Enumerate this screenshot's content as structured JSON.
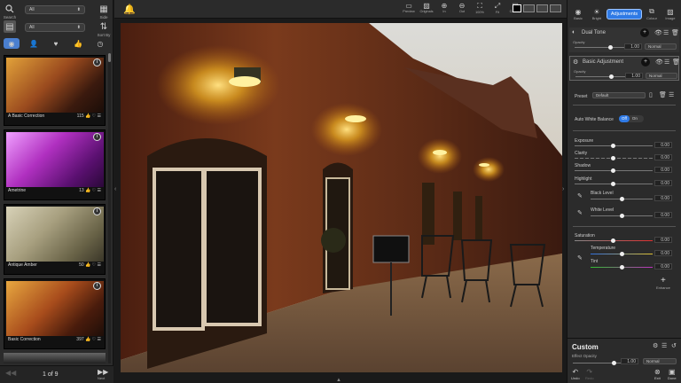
{
  "left_panel": {
    "search_label": "Search",
    "side_label": "Side",
    "sort_label": "Sort By",
    "filter_top": "All",
    "filter_bottom": "All",
    "category_icons": [
      "grid-icon",
      "person-icon",
      "heart-icon",
      "thumbs-up-icon",
      "clock-icon"
    ],
    "presets": [
      {
        "name": "A Basic Correction",
        "count": "115"
      },
      {
        "name": "Ametrine",
        "count": "13"
      },
      {
        "name": "Antique Amber",
        "count": "50"
      },
      {
        "name": "Basic Correction",
        "count": "397"
      }
    ],
    "pager": {
      "text": "1 of 9",
      "next_label": "Next"
    }
  },
  "toolbar": {
    "buttons": [
      "Preview",
      "Originals",
      "In",
      "Out",
      "100%",
      "Fit",
      "Canvas"
    ]
  },
  "right_panel": {
    "tabs": [
      "Basic",
      "Bright",
      "Adjustments",
      "Colour",
      "Image"
    ],
    "active_tab": "Adjustments",
    "layers": [
      {
        "name": "Dual Tone",
        "opacity_label": "Opacity",
        "opacity": "1.00",
        "blend": "Normal"
      },
      {
        "name": "Basic Adjustment",
        "opacity_label": "Opacity",
        "opacity": "1.00",
        "blend": "Normal"
      }
    ],
    "preset_label": "Preset",
    "preset_value": "Default",
    "awb_label": "Auto White Balance",
    "awb_off": "Off",
    "awb_on": "On",
    "sliders": [
      {
        "label": "Exposure",
        "value": "0.00"
      },
      {
        "label": "Clarity",
        "value": "0.00"
      },
      {
        "label": "Shadow",
        "value": "0.00"
      },
      {
        "label": "Highlight",
        "value": "0.00"
      },
      {
        "label": "Black Level",
        "value": "0.00"
      },
      {
        "label": "White Level",
        "value": "0.00"
      },
      {
        "label": "Saturation",
        "value": "0.00"
      },
      {
        "label": "Temperature",
        "value": "0.00"
      },
      {
        "label": "Tint",
        "value": "0.00"
      }
    ],
    "enhance_label": "Enhance",
    "custom_title": "Custom",
    "effect_opacity_label": "Effect Opacity",
    "effect_opacity": "1.00",
    "effect_blend": "Normal",
    "bottom_buttons": [
      "Undo",
      "Redo",
      "Exit",
      "Done"
    ]
  }
}
